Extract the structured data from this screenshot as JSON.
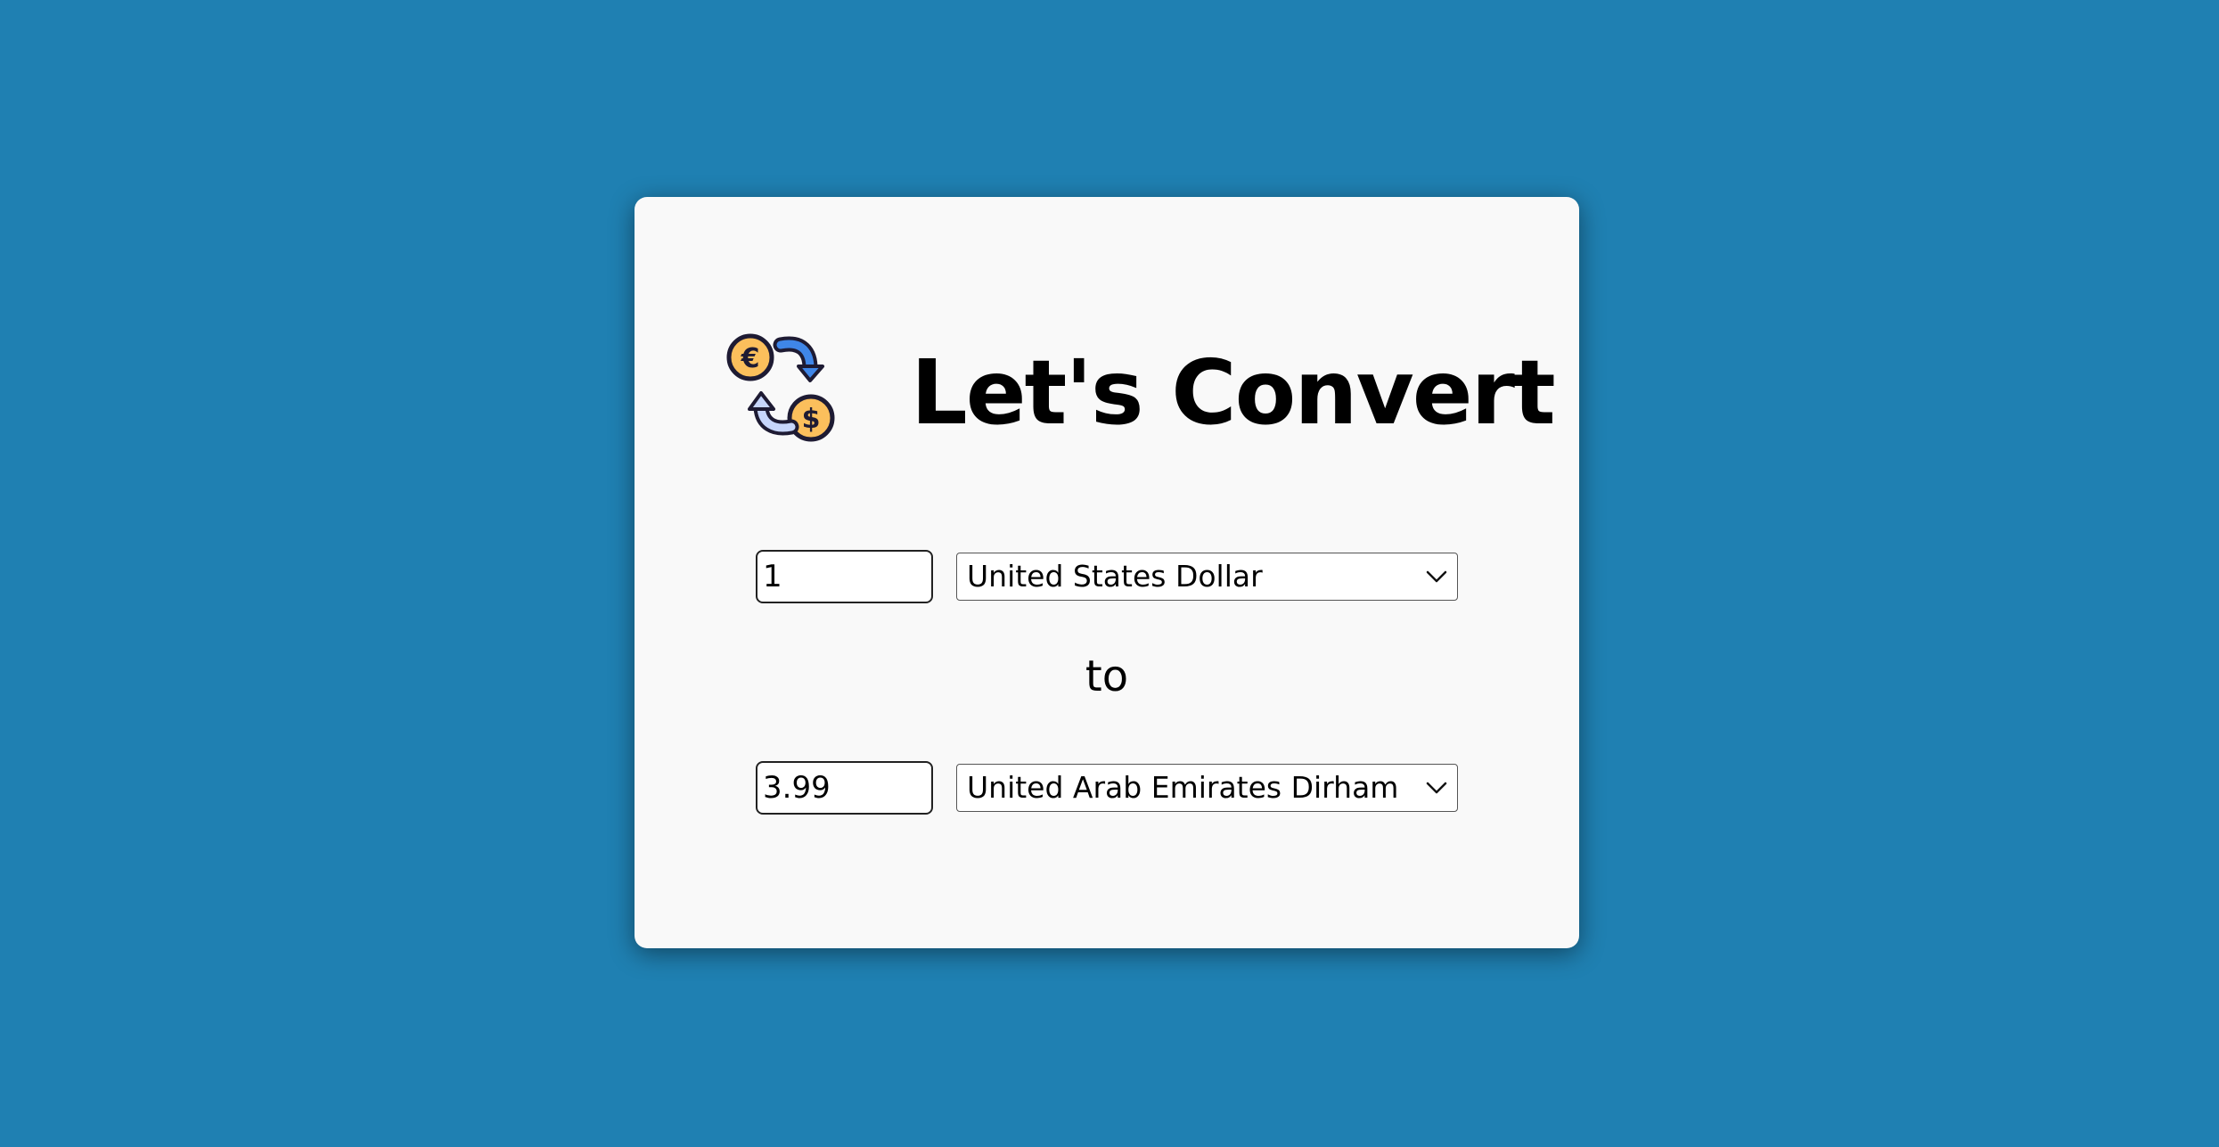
{
  "app": {
    "title": "Let's Convert",
    "logo_icon": "currency-exchange-icon"
  },
  "converter": {
    "from": {
      "amount": "1",
      "currency": "United States Dollar"
    },
    "separator": "to",
    "to": {
      "amount": "3.99",
      "currency": "United Arab Emirates Dirham"
    }
  },
  "colors": {
    "background": "#1f80b2",
    "card": "#f9f9f9",
    "coin": "#fbbf5c",
    "arrow_blue": "#3f86e8",
    "arrow_light": "#c7d6fb"
  }
}
